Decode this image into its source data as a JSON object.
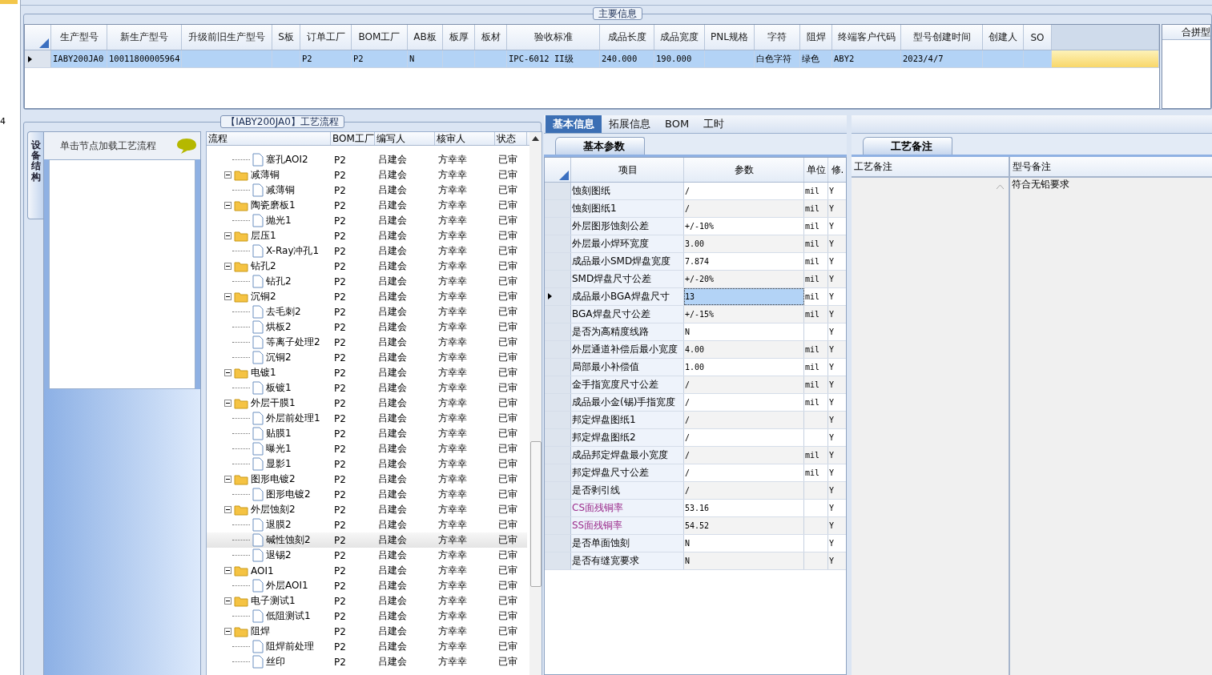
{
  "edge_text": "4",
  "main_info": {
    "title": "主要信息",
    "columns": [
      "生产型号",
      "新生产型号",
      "升级前旧生产型号",
      "S板",
      "订单工厂",
      "BOM工厂",
      "AB板",
      "板厚",
      "板材",
      "验收标准",
      "成品长度",
      "成品宽度",
      "PNL规格",
      "字符",
      "阻焊",
      "终端客户代码",
      "型号创建时间",
      "创建人",
      "SO"
    ],
    "rows": [
      {
        "selected": true,
        "cells": [
          "IABY200JA0",
          "10011800005964",
          null,
          null,
          "P2",
          "P2",
          "N",
          null,
          null,
          "IPC-6012 II级",
          "240.000",
          "190.000",
          null,
          "白色字符",
          "绿色",
          "ABY2",
          "2023/4/7",
          null,
          null
        ]
      }
    ],
    "side_panel": {
      "title": "合拼型"
    }
  },
  "flow": {
    "title": "【IABY200JA0】工艺流程",
    "vertical_tab": "设备结构",
    "hint": "单击节点加载工艺流程",
    "columns": [
      "流程",
      "BOM工厂",
      "编写人",
      "核审人",
      "状态"
    ],
    "nodes": [
      {
        "kind": "continued",
        "children": [
          {
            "label": "塞孔AOI2",
            "bom": "P2",
            "writer": "吕建会",
            "reviewer": "方幸幸",
            "status": "已审",
            "selected": false
          }
        ]
      },
      {
        "kind": "folder",
        "label": "减薄铜",
        "bom": "P2",
        "writer": "吕建会",
        "reviewer": "方幸幸",
        "status": "已审",
        "selected": false,
        "expanded": true,
        "children": [
          {
            "label": "减薄铜",
            "bom": "P2",
            "writer": "吕建会",
            "reviewer": "方幸幸",
            "status": "已审",
            "selected": false
          }
        ]
      },
      {
        "kind": "folder",
        "label": "陶瓷磨板1",
        "bom": "P2",
        "writer": "吕建会",
        "reviewer": "方幸幸",
        "status": "已审",
        "selected": false,
        "expanded": true,
        "children": [
          {
            "label": "抛光1",
            "bom": "P2",
            "writer": "吕建会",
            "reviewer": "方幸幸",
            "status": "已审",
            "selected": false
          }
        ]
      },
      {
        "kind": "folder",
        "label": "层压1",
        "bom": "P2",
        "writer": "吕建会",
        "reviewer": "方幸幸",
        "status": "已审",
        "selected": false,
        "expanded": true,
        "children": [
          {
            "label": "X-Ray冲孔1",
            "bom": "P2",
            "writer": "吕建会",
            "reviewer": "方幸幸",
            "status": "已审",
            "selected": false
          }
        ]
      },
      {
        "kind": "folder",
        "label": "钻孔2",
        "bom": "P2",
        "writer": "吕建会",
        "reviewer": "方幸幸",
        "status": "已审",
        "selected": false,
        "expanded": true,
        "children": [
          {
            "label": "钻孔2",
            "bom": "P2",
            "writer": "吕建会",
            "reviewer": "方幸幸",
            "status": "已审",
            "selected": false
          }
        ]
      },
      {
        "kind": "folder",
        "label": "沉铜2",
        "bom": "P2",
        "writer": "吕建会",
        "reviewer": "方幸幸",
        "status": "已审",
        "selected": false,
        "expanded": true,
        "children": [
          {
            "label": "去毛刺2",
            "bom": "P2",
            "writer": "吕建会",
            "reviewer": "方幸幸",
            "status": "已审",
            "selected": false
          },
          {
            "label": "烘板2",
            "bom": "P2",
            "writer": "吕建会",
            "reviewer": "方幸幸",
            "status": "已审",
            "selected": false
          },
          {
            "label": "等离子处理2",
            "bom": "P2",
            "writer": "吕建会",
            "reviewer": "方幸幸",
            "status": "已审",
            "selected": false
          },
          {
            "label": "沉铜2",
            "bom": "P2",
            "writer": "吕建会",
            "reviewer": "方幸幸",
            "status": "已审",
            "selected": false
          }
        ]
      },
      {
        "kind": "folder",
        "label": "电镀1",
        "bom": "P2",
        "writer": "吕建会",
        "reviewer": "方幸幸",
        "status": "已审",
        "selected": false,
        "expanded": true,
        "children": [
          {
            "label": "板镀1",
            "bom": "P2",
            "writer": "吕建会",
            "reviewer": "方幸幸",
            "status": "已审",
            "selected": false
          }
        ]
      },
      {
        "kind": "folder",
        "label": "外层干膜1",
        "bom": "P2",
        "writer": "吕建会",
        "reviewer": "方幸幸",
        "status": "已审",
        "selected": false,
        "expanded": true,
        "children": [
          {
            "label": "外层前处理1",
            "bom": "P2",
            "writer": "吕建会",
            "reviewer": "方幸幸",
            "status": "已审",
            "selected": false
          },
          {
            "label": "贴膜1",
            "bom": "P2",
            "writer": "吕建会",
            "reviewer": "方幸幸",
            "status": "已审",
            "selected": false
          },
          {
            "label": "曝光1",
            "bom": "P2",
            "writer": "吕建会",
            "reviewer": "方幸幸",
            "status": "已审",
            "selected": false
          },
          {
            "label": "显影1",
            "bom": "P2",
            "writer": "吕建会",
            "reviewer": "方幸幸",
            "status": "已审",
            "selected": false
          }
        ]
      },
      {
        "kind": "folder",
        "label": "图形电镀2",
        "bom": "P2",
        "writer": "吕建会",
        "reviewer": "方幸幸",
        "status": "已审",
        "selected": false,
        "expanded": true,
        "children": [
          {
            "label": "图形电镀2",
            "bom": "P2",
            "writer": "吕建会",
            "reviewer": "方幸幸",
            "status": "已审",
            "selected": false
          }
        ]
      },
      {
        "kind": "folder",
        "label": "外层蚀刻2",
        "bom": "P2",
        "writer": "吕建会",
        "reviewer": "方幸幸",
        "status": "已审",
        "selected": false,
        "expanded": true,
        "children": [
          {
            "label": "退膜2",
            "bom": "P2",
            "writer": "吕建会",
            "reviewer": "方幸幸",
            "status": "已审",
            "selected": false
          },
          {
            "label": "碱性蚀刻2",
            "bom": "P2",
            "writer": "吕建会",
            "reviewer": "方幸幸",
            "status": "已审",
            "selected": true
          },
          {
            "label": "退锡2",
            "bom": "P2",
            "writer": "吕建会",
            "reviewer": "方幸幸",
            "status": "已审",
            "selected": false
          }
        ]
      },
      {
        "kind": "folder",
        "label": "AOI1",
        "bom": "P2",
        "writer": "吕建会",
        "reviewer": "方幸幸",
        "status": "已审",
        "selected": false,
        "expanded": true,
        "children": [
          {
            "label": "外层AOI1",
            "bom": "P2",
            "writer": "吕建会",
            "reviewer": "方幸幸",
            "status": "已审",
            "selected": false
          }
        ]
      },
      {
        "kind": "folder",
        "label": "电子测试1",
        "bom": "P2",
        "writer": "吕建会",
        "reviewer": "方幸幸",
        "status": "已审",
        "selected": false,
        "expanded": true,
        "children": [
          {
            "label": "低阻测试1",
            "bom": "P2",
            "writer": "吕建会",
            "reviewer": "方幸幸",
            "status": "已审",
            "selected": false
          }
        ]
      },
      {
        "kind": "folder",
        "label": "阻焊",
        "bom": "P2",
        "writer": "吕建会",
        "reviewer": "方幸幸",
        "status": "已审",
        "selected": false,
        "expanded": true,
        "children": [
          {
            "label": "阻焊前处理",
            "bom": "P2",
            "writer": "吕建会",
            "reviewer": "方幸幸",
            "status": "已审",
            "selected": false
          },
          {
            "label": "丝印",
            "bom": "P2",
            "writer": "吕建会",
            "reviewer": "方幸幸",
            "status": "已审",
            "selected": false
          }
        ]
      }
    ]
  },
  "detail": {
    "tabs": [
      {
        "label": "基本信息",
        "selected": true
      },
      {
        "label": "拓展信息",
        "selected": false
      },
      {
        "label": "BOM",
        "selected": false
      },
      {
        "label": "工时",
        "selected": false
      }
    ],
    "sub_tab": "基本参数",
    "columns": [
      "项目",
      "参数",
      "单位",
      "修."
    ],
    "rows": [
      {
        "item": "蚀刻图纸",
        "value": "/",
        "unit": "mil",
        "mod": "Y",
        "selected": false
      },
      {
        "item": "蚀刻图纸1",
        "value": "/",
        "unit": "mil",
        "mod": "Y",
        "selected": false
      },
      {
        "item": "外层图形蚀刻公差",
        "value": "+/-10%",
        "unit": "mil",
        "mod": "Y",
        "selected": false
      },
      {
        "item": "外层最小焊环宽度",
        "value": "3.00",
        "unit": "mil",
        "mod": "Y",
        "selected": false
      },
      {
        "item": "成品最小SMD焊盘宽度",
        "value": "7.874",
        "unit": "mil",
        "mod": "Y",
        "selected": false
      },
      {
        "item": "SMD焊盘尺寸公差",
        "value": "+/-20%",
        "unit": "mil",
        "mod": "Y",
        "selected": false
      },
      {
        "item": "成品最小BGA焊盘尺寸",
        "value": "13",
        "unit": "mil",
        "mod": "Y",
        "selected": true
      },
      {
        "item": "BGA焊盘尺寸公差",
        "value": "+/-15%",
        "unit": "mil",
        "mod": "Y",
        "selected": false
      },
      {
        "item": "是否为高精度线路",
        "value": "N",
        "mod": "Y",
        "selected": false
      },
      {
        "item": "外层通道补偿后最小宽度",
        "value": "4.00",
        "unit": "mil",
        "mod": "Y",
        "selected": false
      },
      {
        "item": "局部最小补偿值",
        "value": "1.00",
        "unit": "mil",
        "mod": "Y",
        "selected": false
      },
      {
        "item": "金手指宽度尺寸公差",
        "value": "/",
        "unit": "mil",
        "mod": "Y",
        "selected": false
      },
      {
        "item": "成品最小金(锡)手指宽度",
        "value": "/",
        "unit": "mil",
        "mod": "Y",
        "selected": false
      },
      {
        "item": "邦定焊盘图纸1",
        "value": "/",
        "mod": "Y",
        "selected": false
      },
      {
        "item": "邦定焊盘图纸2",
        "value": "/",
        "mod": "Y",
        "selected": false
      },
      {
        "item": "成品邦定焊盘最小宽度",
        "value": "/",
        "unit": "mil",
        "mod": "Y",
        "selected": false
      },
      {
        "item": "邦定焊盘尺寸公差",
        "value": "/",
        "unit": "mil",
        "mod": "Y",
        "selected": false
      },
      {
        "item": "是否剥引线",
        "value": "/",
        "mod": "Y",
        "selected": false
      },
      {
        "item": "CS面残铜率",
        "value": "53.16",
        "mod": "Y",
        "selected": false,
        "color": "#9b2c8c"
      },
      {
        "item": "SS面残铜率",
        "value": "54.52",
        "mod": "Y",
        "selected": false,
        "color": "#9b2c8c"
      },
      {
        "item": "是否单面蚀刻",
        "value": "N",
        "mod": "Y",
        "selected": false
      },
      {
        "item": "是否有缝宽要求",
        "value": "N",
        "mod": "Y",
        "selected": false
      }
    ]
  },
  "notes": {
    "tab": "工艺备注",
    "columns": [
      "工艺备注",
      "型号备注"
    ],
    "model_note": "符合无铅要求"
  }
}
